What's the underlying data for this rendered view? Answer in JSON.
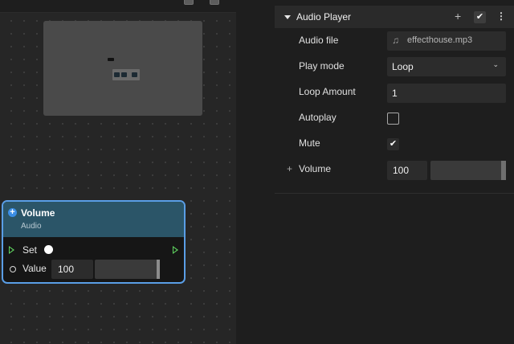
{
  "graph": {
    "node": {
      "title": "Volume",
      "subtitle": "Audio",
      "set_label": "Set",
      "value_label": "Value",
      "value": "100",
      "slider_level": 1.0,
      "accent_color": "#5a9ee6",
      "header_color": "#2b5568"
    }
  },
  "inspector": {
    "component_title": "Audio Player",
    "header_icons": [
      "add-icon",
      "check-icon",
      "more-icon"
    ],
    "properties": {
      "audio_file": {
        "label": "Audio file",
        "value": "effecthouse.mp3",
        "icon": "music-note-icon"
      },
      "play_mode": {
        "label": "Play mode",
        "value": "Loop"
      },
      "loop_amount": {
        "label": "Loop Amount",
        "value": "1"
      },
      "autoplay": {
        "label": "Autoplay",
        "checked": false
      },
      "mute": {
        "label": "Mute",
        "checked": true
      },
      "volume": {
        "label": "Volume",
        "value": "100",
        "slider_level": 1.0
      }
    }
  }
}
